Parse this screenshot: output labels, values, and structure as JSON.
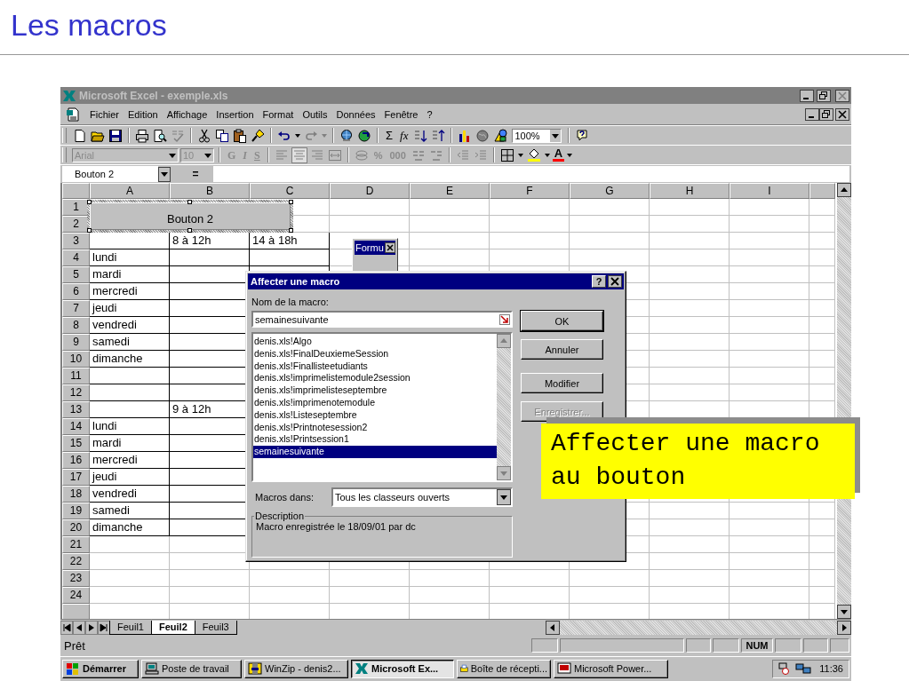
{
  "slide_title": "Les macros",
  "window": {
    "title": "Microsoft Excel - exemple.xls",
    "active": false
  },
  "menu": [
    "Fichier",
    "Edition",
    "Affichage",
    "Insertion",
    "Format",
    "Outils",
    "Données",
    "Fenêtre",
    "?"
  ],
  "standard_toolbar": {
    "sum": "Σ",
    "function": "fx",
    "zoom": "100%"
  },
  "format_toolbar": {
    "font": "Arial",
    "size": "10",
    "disabled": true,
    "styles": [
      "G",
      "I",
      "S"
    ],
    "percent": "%",
    "thousands": "000",
    "font_color": "A"
  },
  "formula_bar": {
    "name_box": "Bouton 2",
    "equals": "="
  },
  "columns": [
    "A",
    "B",
    "C",
    "D",
    "E",
    "F",
    "G",
    "H",
    "I"
  ],
  "rows": [
    {
      "header": "1",
      "boxed": false
    },
    {
      "header": "2",
      "boxed": false
    },
    {
      "header": "3",
      "boxed": true,
      "b": "8 à 12h",
      "c": "14 à 18h"
    },
    {
      "header": "4",
      "boxed": true,
      "a": "lundi"
    },
    {
      "header": "5",
      "boxed": true,
      "a": "mardi"
    },
    {
      "header": "6",
      "boxed": true,
      "a": "mercredi"
    },
    {
      "header": "7",
      "boxed": true,
      "a": "jeudi"
    },
    {
      "header": "8",
      "boxed": true,
      "a": "vendredi"
    },
    {
      "header": "9",
      "boxed": true,
      "a": "samedi"
    },
    {
      "header": "10",
      "boxed": true,
      "a": "dimanche"
    },
    {
      "header": "11",
      "boxed": true
    },
    {
      "header": "12",
      "boxed": true
    },
    {
      "header": "13",
      "boxed": true,
      "b": "9 à 12h"
    },
    {
      "header": "14",
      "boxed": true,
      "a": "lundi"
    },
    {
      "header": "15",
      "boxed": true,
      "a": "mardi"
    },
    {
      "header": "16",
      "boxed": true,
      "a": "mercredi"
    },
    {
      "header": "17",
      "boxed": true,
      "a": "jeudi"
    },
    {
      "header": "18",
      "boxed": true,
      "a": "vendredi"
    },
    {
      "header": "19",
      "boxed": true,
      "a": "samedi"
    },
    {
      "header": "20",
      "boxed": true,
      "a": "dimanche"
    },
    {
      "header": "21",
      "boxed": false
    },
    {
      "header": "22",
      "boxed": false
    },
    {
      "header": "23",
      "boxed": false
    },
    {
      "header": "24",
      "boxed": false
    }
  ],
  "embedded_button": {
    "label": "Bouton 2",
    "selected": true
  },
  "forms_toolbar": {
    "title": "Formu"
  },
  "dialog": {
    "title": "Affecter une macro",
    "help": "?",
    "name_label": "Nom de la macro:",
    "name_value": "semainesuivante",
    "macros": [
      {
        "name": "denis.xls!Algo",
        "selected": false
      },
      {
        "name": "denis.xls!FinalDeuxiemeSession",
        "selected": false
      },
      {
        "name": "denis.xls!Finallisteetudiants",
        "selected": false
      },
      {
        "name": "denis.xls!imprimelistemodule2session",
        "selected": false
      },
      {
        "name": "denis.xls!imprimelisteseptembre",
        "selected": false
      },
      {
        "name": "denis.xls!imprimenotemodule",
        "selected": false
      },
      {
        "name": "denis.xls!Listeseptembre",
        "selected": false
      },
      {
        "name": "denis.xls!Printnotesession2",
        "selected": false
      },
      {
        "name": "denis.xls!Printsession1",
        "selected": false
      },
      {
        "name": "semainesuivante",
        "selected": true
      }
    ],
    "buttons": [
      {
        "label": "OK",
        "disabled": false
      },
      {
        "label": "Annuler",
        "disabled": false
      },
      {
        "label": "Modifier",
        "disabled": false
      },
      {
        "label": "Enregistrer...",
        "disabled": true
      }
    ],
    "macros_in_label": "Macros dans:",
    "macros_in_value": "Tous les classeurs ouverts",
    "description_label": "Description",
    "description": "Macro enregistrée le 18/09/01 par dc"
  },
  "sheet_tabs": [
    {
      "label": "Feuil1",
      "selected": false
    },
    {
      "label": "Feuil2",
      "selected": true
    },
    {
      "label": "Feuil3",
      "selected": false
    }
  ],
  "status_bar": {
    "text": "Prêt",
    "indicator": "NUM"
  },
  "taskbar": {
    "start": "Démarrer",
    "clock": "11:36",
    "tasks": [
      {
        "label": "Poste de travail",
        "kind": "computer",
        "selected": false
      },
      {
        "label": "WinZip - denis2...",
        "kind": "archive",
        "selected": false
      },
      {
        "label": "Microsoft Ex...",
        "kind": "spreadsheet",
        "selected": true
      },
      {
        "label": "Boîte de récepti...",
        "kind": "inbox",
        "selected": false
      },
      {
        "label": "Microsoft Power...",
        "kind": "presentation",
        "selected": false
      }
    ]
  },
  "callout": {
    "text": "Affecter une macro au bouton"
  }
}
